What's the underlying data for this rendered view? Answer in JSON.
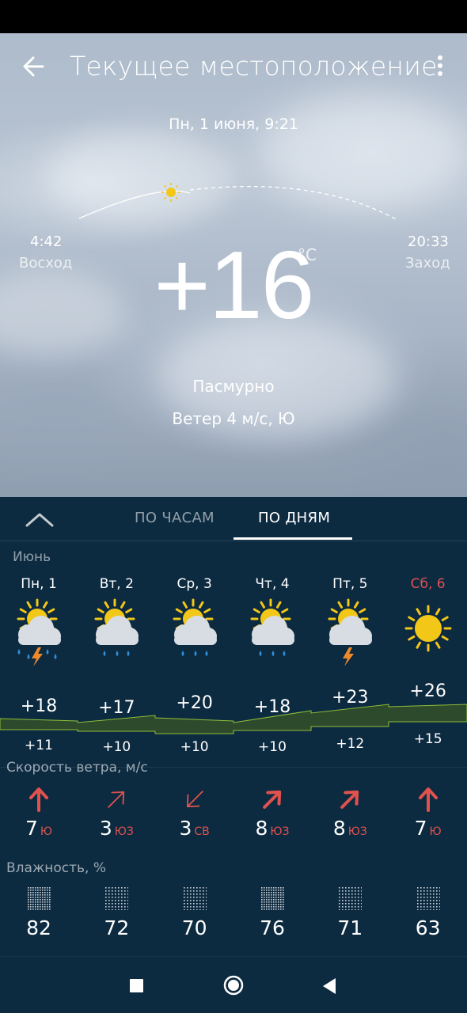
{
  "header": {
    "title": "Текущее местоположение",
    "datetime": "Пн, 1 июня, 9:21"
  },
  "current": {
    "temperature": "+16",
    "unit": "°C",
    "condition": "Пасмурно",
    "wind": "Ветер 4 м/с, Ю",
    "sunrise_time": "4:42",
    "sunrise_label": "Восход",
    "sunset_time": "20:33",
    "sunset_label": "Заход"
  },
  "tabs": {
    "hourly": "ПО ЧАСАМ",
    "daily": "ПО ДНЯМ"
  },
  "month": "Июнь",
  "sections": {
    "wind": "Скорость ветра, м/с",
    "humidity": "Влажность, %"
  },
  "days": [
    {
      "name": "Пн, 1",
      "icon": "partly-cloudy-thunder-rain-icon",
      "max": "+18",
      "min": "+11",
      "wind_speed": "7",
      "wind_dir": "Ю",
      "humidity": "82"
    },
    {
      "name": "Вт, 2",
      "icon": "partly-cloudy-rain-icon",
      "max": "+17",
      "min": "+10",
      "wind_speed": "3",
      "wind_dir": "ЮЗ",
      "humidity": "72"
    },
    {
      "name": "Ср, 3",
      "icon": "partly-cloudy-rain-icon",
      "max": "+20",
      "min": "+10",
      "wind_speed": "3",
      "wind_dir": "СВ",
      "humidity": "70"
    },
    {
      "name": "Чт, 4",
      "icon": "partly-cloudy-rain-icon",
      "max": "+18",
      "min": "+10",
      "wind_speed": "8",
      "wind_dir": "ЮЗ",
      "humidity": "76"
    },
    {
      "name": "Пт, 5",
      "icon": "partly-cloudy-thunder-icon",
      "max": "+23",
      "min": "+12",
      "wind_speed": "8",
      "wind_dir": "ЮЗ",
      "humidity": "71"
    },
    {
      "name": "Сб, 6",
      "icon": "sun-icon",
      "max": "+26",
      "min": "+15",
      "wind_speed": "7",
      "wind_dir": "Ю",
      "humidity": "63"
    }
  ],
  "colors": {
    "panel": "#0c2a40",
    "weekend": "#e0524e",
    "wind_arrow": "#e0524e",
    "sun": "#f2c718",
    "temp_band": "#2e4a2c"
  }
}
